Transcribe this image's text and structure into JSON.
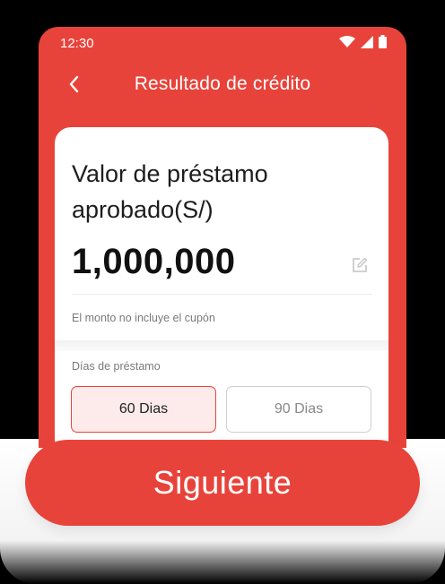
{
  "status_bar": {
    "time": "12:30"
  },
  "header": {
    "title": "Resultado de crédito"
  },
  "loan": {
    "label": "Valor de préstamo aprobado(S/)",
    "amount": "1,000,000",
    "note": "El monto no incluye el cupón"
  },
  "days": {
    "label": "Días de préstamo",
    "options": [
      {
        "label": "60 Dias",
        "selected": true
      },
      {
        "label": "90 Dias",
        "selected": false
      }
    ]
  },
  "actions": {
    "next_label": "Siguiente"
  },
  "colors": {
    "accent": "#e8433a",
    "selected_bg": "#fdeaea"
  }
}
